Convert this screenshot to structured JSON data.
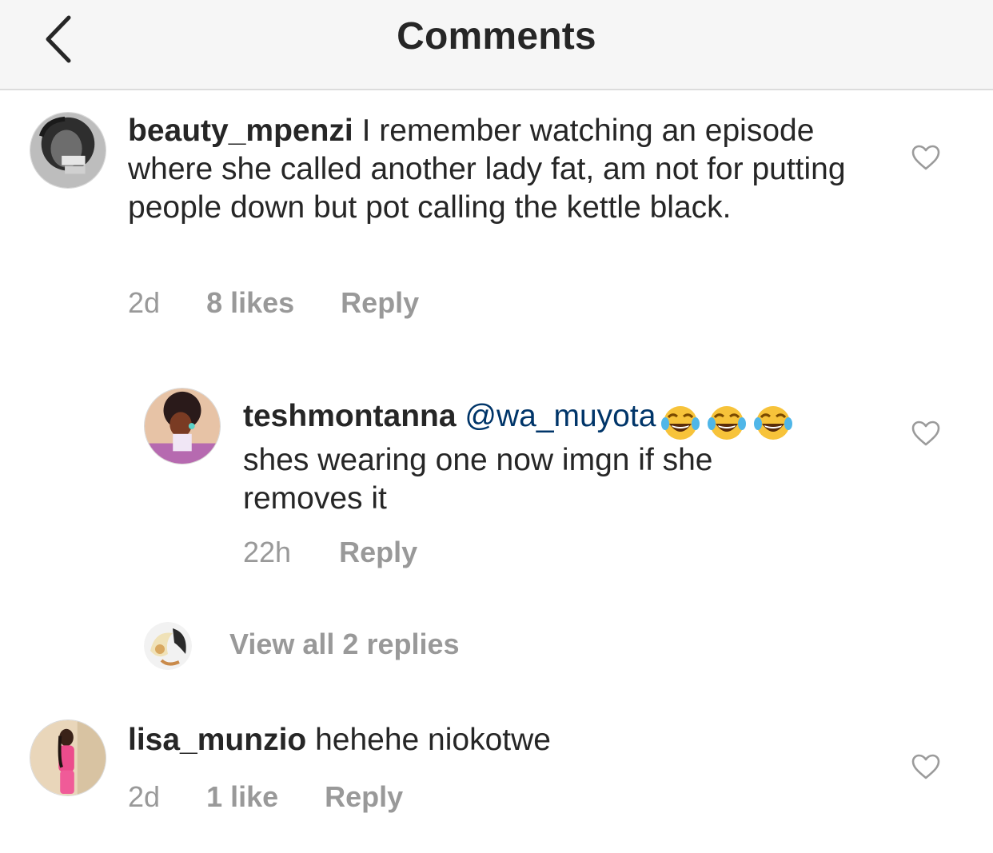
{
  "header": {
    "title": "Comments",
    "back_icon": "chevron-left-icon"
  },
  "colors": {
    "header_bg": "#f6f6f6",
    "text": "#262626",
    "muted": "#999999",
    "mention": "#003569",
    "heart_outline": "#9b9b9b"
  },
  "comments": [
    {
      "username": "beauty_mpenzi",
      "text": "I remember watching an episode where she called another lady fat, am not for putting people down but pot calling the kettle black.",
      "time": "2d",
      "likes": "8 likes",
      "reply": "Reply"
    },
    {
      "username": "teshmontanna",
      "mention": "@wa_muyota",
      "text": "shes wearing one now imgn if she removes it",
      "emoji": "face-with-tears-of-joy",
      "emoji_count": 3,
      "time": "22h",
      "reply": "Reply"
    },
    {
      "username": "lisa_munzio",
      "text": "hehehe niokotwe",
      "time": "2d",
      "likes": "1 like",
      "reply": "Reply"
    }
  ],
  "view_replies": "View all 2 replies"
}
